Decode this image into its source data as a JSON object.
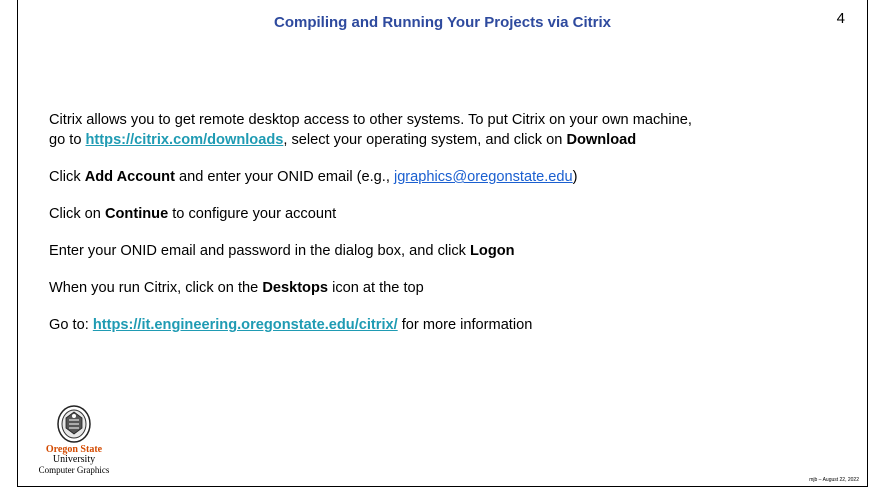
{
  "slide": {
    "title": "Compiling and Running Your Projects via Citrix",
    "page_number": "4",
    "paragraphs": {
      "p1": {
        "line1": "Citrix allows you to get remote desktop access to other systems.  To put Citrix on your own machine,",
        "go_to": "go to  ",
        "link": "https://citrix.com/downloads",
        "mid": ",  select your operating system, and click on ",
        "bold_end": "Download"
      },
      "p2": {
        "pre": "Click ",
        "bold": "Add Account",
        "mid": " and enter your ONID email (e.g., ",
        "link": "jgraphics@oregonstate.edu",
        "end": ")"
      },
      "p3": {
        "pre": "Click on ",
        "bold": "Continue",
        "end": " to configure your account"
      },
      "p4": {
        "pre": "Enter your ONID email and password in the dialog box, and click ",
        "bold": "Logon"
      },
      "p5": {
        "pre": "When you run Citrix, click on the ",
        "bold": "Desktops",
        "end": " icon at the top"
      },
      "p6": {
        "pre": "Go to:  ",
        "link": "https://it.engineering.oregonstate.edu/citrix/",
        "end": "  for more information"
      }
    },
    "logo": {
      "line1": "Oregon State",
      "line2": "University",
      "line3": "Computer Graphics",
      "icon": "osu-seal-icon"
    },
    "footer": "mjb – August 22, 2022"
  },
  "colors": {
    "title": "#2e4a9e",
    "link_bold": "#1f9bb3",
    "link_plain": "#1a5fd0",
    "logo_orange": "#d34a00"
  }
}
